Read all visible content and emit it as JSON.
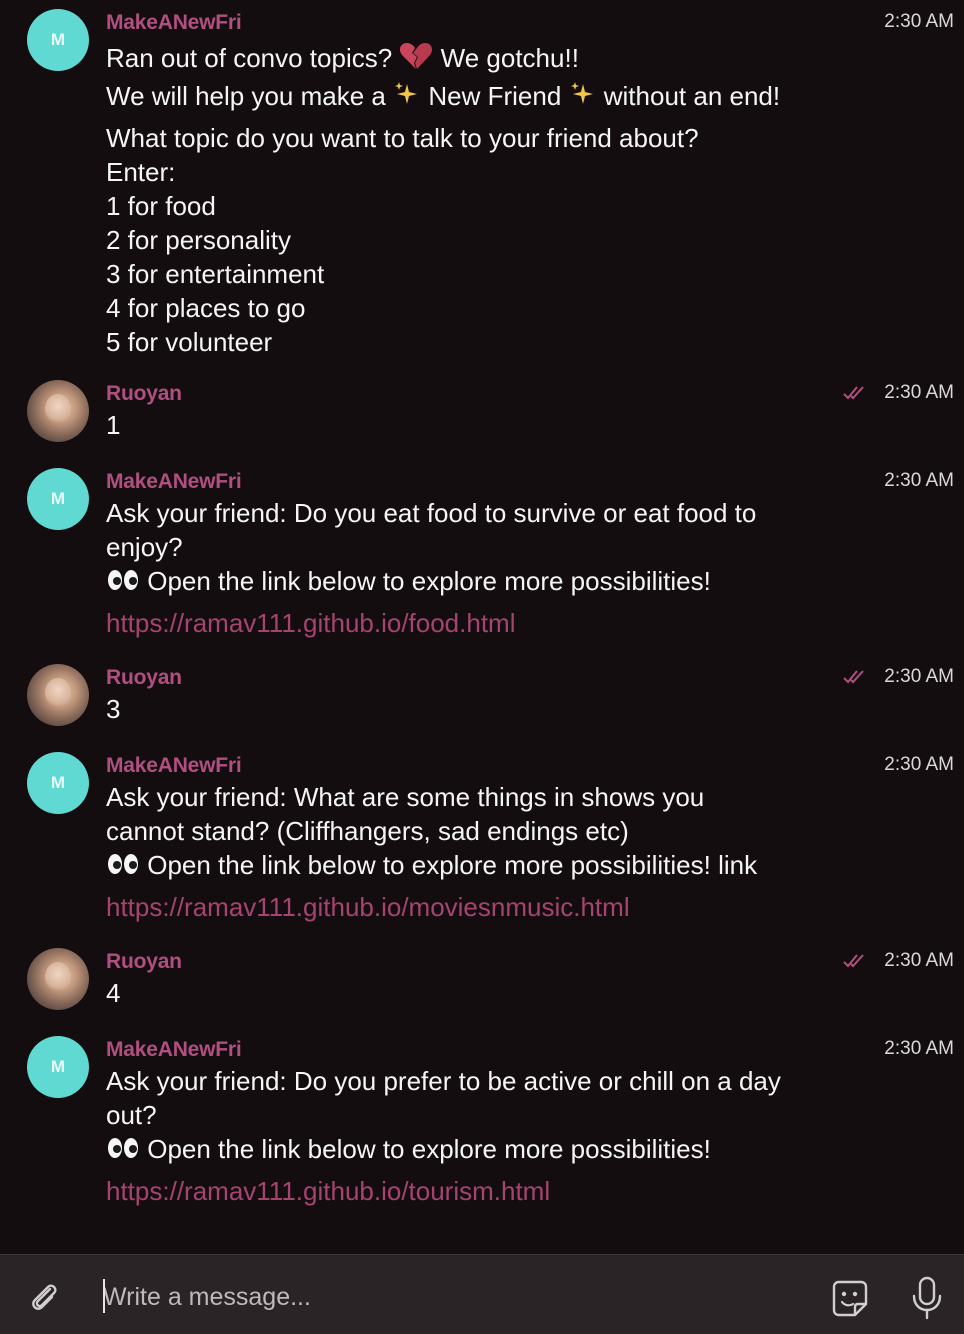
{
  "messages": [
    {
      "sender": "MakeANewFri",
      "avatar_letter": "M",
      "time": "2:30 AM",
      "text_line_1a": "Ran out of convo topics?",
      "text_line_1b": "We gotchu!!",
      "text_line_2a": "We will help you make a",
      "text_line_2b": "New Friend",
      "text_line_2c": "without an end!",
      "lines": [
        "What topic do you want to talk to your friend about?",
        "Enter:",
        "1 for food",
        "2 for personality",
        "3 for entertainment",
        "4 for places to go",
        "5 for volunteer"
      ]
    },
    {
      "sender": "Ruoyan",
      "time": "2:30 AM",
      "text": "1"
    },
    {
      "sender": "MakeANewFri",
      "avatar_letter": "M",
      "time": "2:30 AM",
      "lines": [
        "Ask your friend: Do you eat food to survive or eat food to",
        "enjoy?"
      ],
      "cta": "Open the link below to explore more possibilities!",
      "link": "https://ramav111.github.io/food.html"
    },
    {
      "sender": "Ruoyan",
      "time": "2:30 AM",
      "text": "3"
    },
    {
      "sender": "MakeANewFri",
      "avatar_letter": "M",
      "time": "2:30 AM",
      "lines": [
        "Ask your friend: What are some things in shows you",
        "cannot stand? (Cliffhangers, sad endings etc)"
      ],
      "cta": "Open the link below to explore more possibilities! link",
      "link": "https://ramav111.github.io/moviesnmusic.html"
    },
    {
      "sender": "Ruoyan",
      "time": "2:30 AM",
      "text": "4"
    },
    {
      "sender": "MakeANewFri",
      "avatar_letter": "M",
      "time": "2:30 AM",
      "lines": [
        "Ask your friend: Do you prefer to be active or chill on a day",
        "out?"
      ],
      "cta": "Open the link below to explore more possibilities!",
      "link": "https://ramav111.github.io/tourism.html"
    }
  ],
  "composer": {
    "placeholder": "Write a message..."
  },
  "icons": {
    "attach": "paperclip-icon",
    "sticker": "sticker-icon",
    "mic": "microphone-icon",
    "read": "double-check-icon",
    "broken_heart": "broken-heart-emoji",
    "sparkles": "sparkles-emoji",
    "eyes": "eyes-emoji"
  },
  "colors": {
    "background": "#140d10",
    "sender_name": "#b04f80",
    "link": "#a5446f",
    "bot_avatar": "#5fd9d1",
    "read_check": "#b04f80"
  }
}
